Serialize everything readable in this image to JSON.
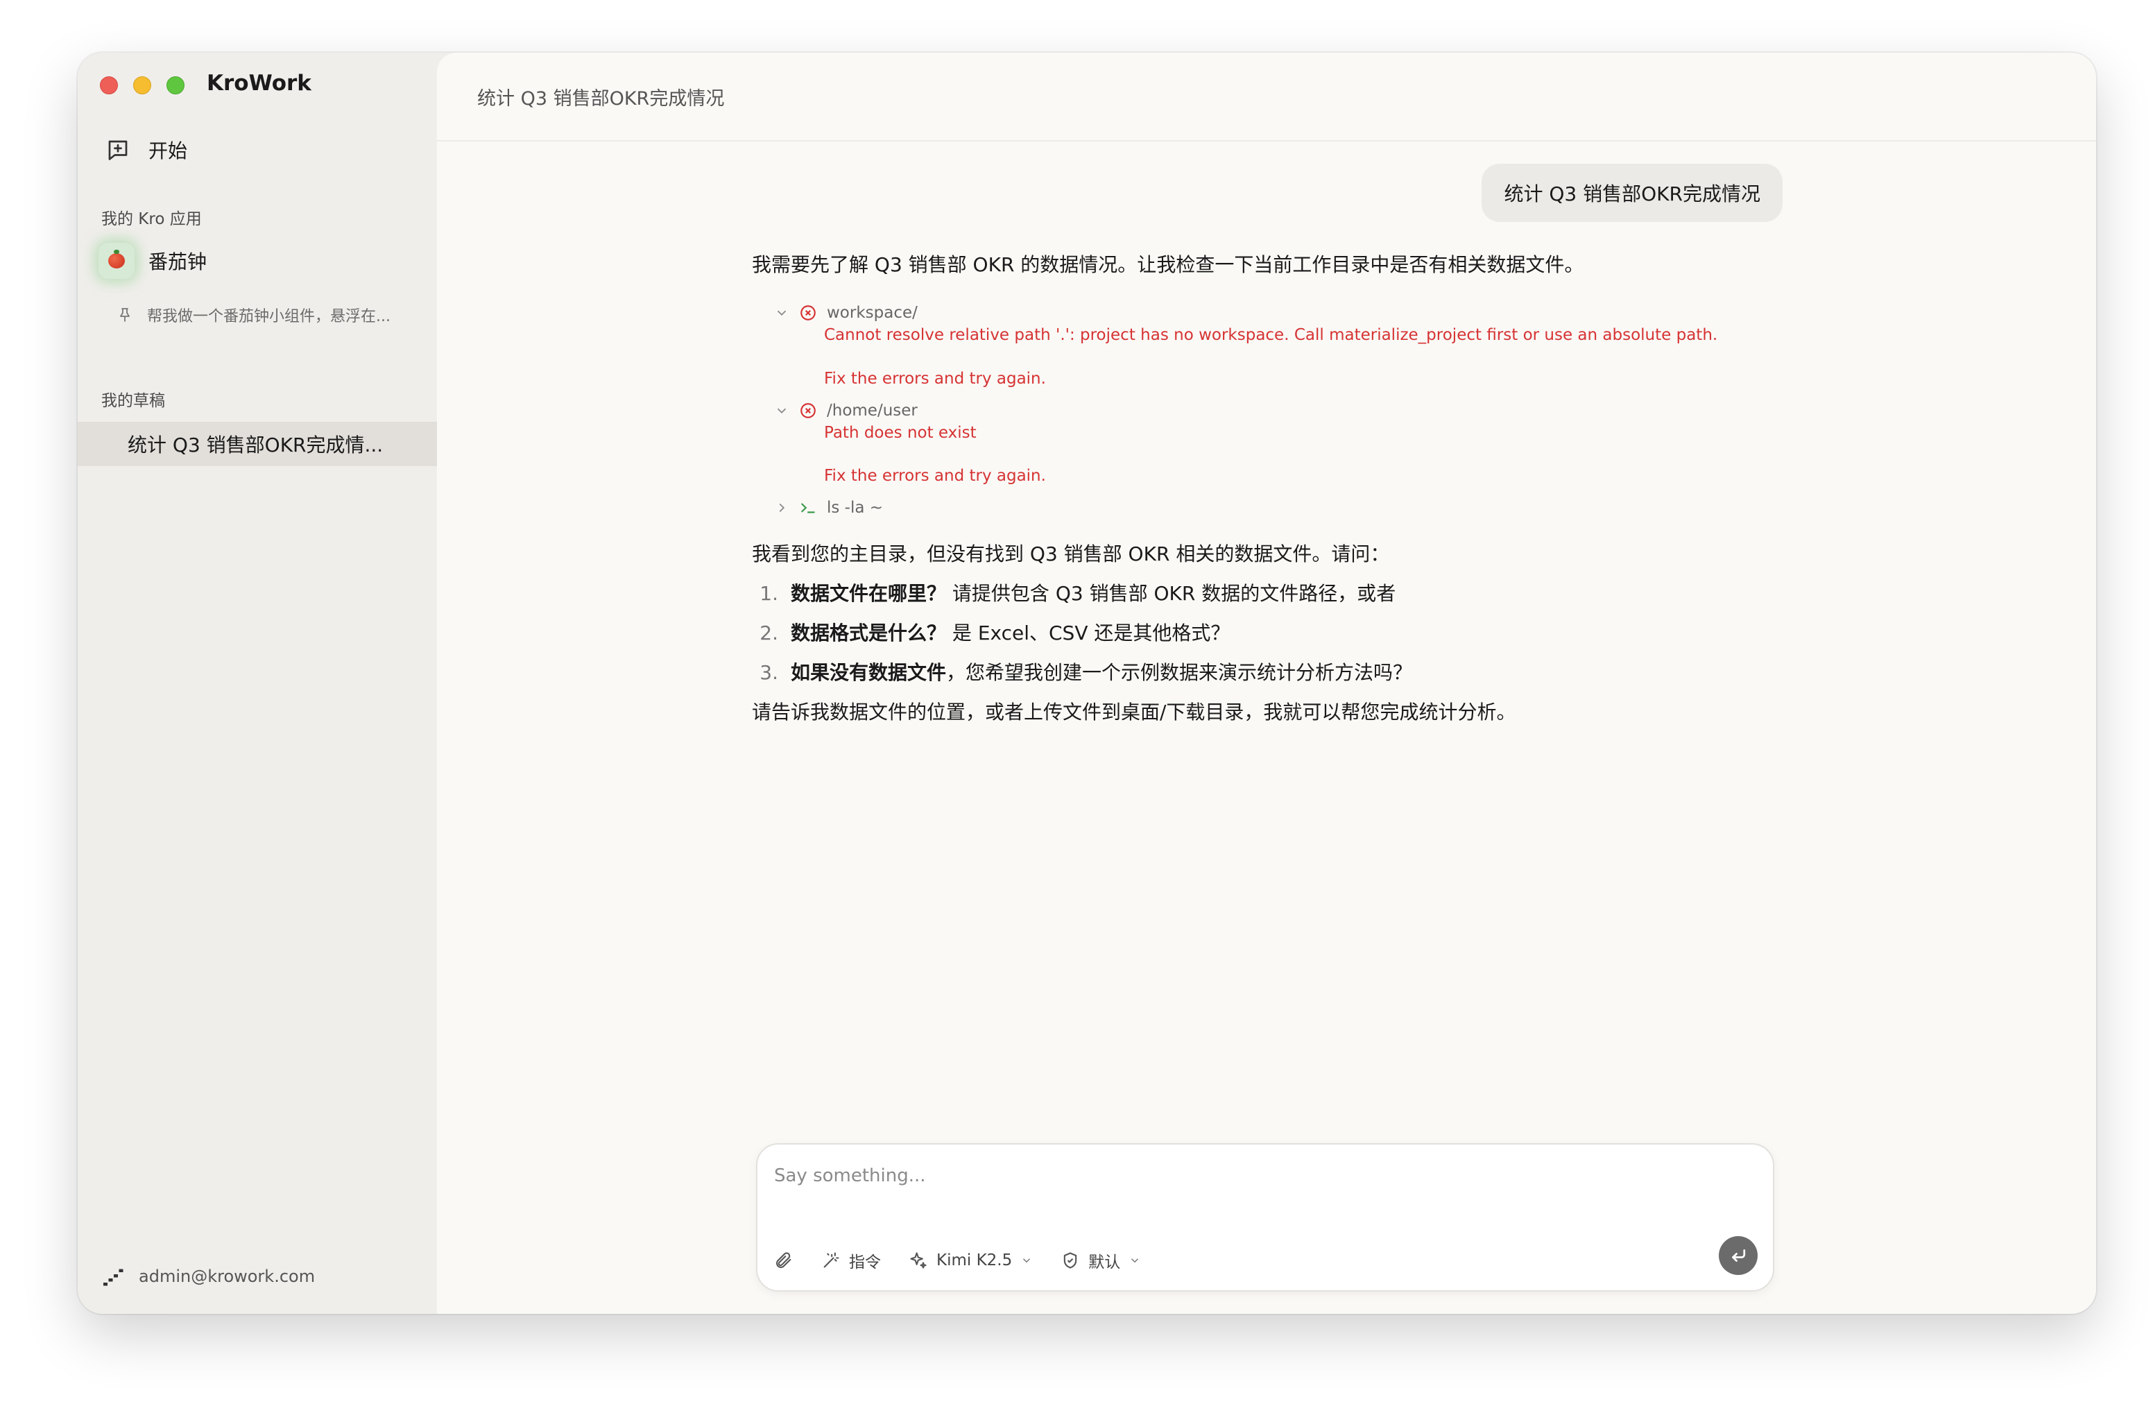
{
  "app": {
    "title": "KroWork"
  },
  "sidebar": {
    "start_label": "开始",
    "apps_section_label": "我的 Kro 应用",
    "app_item_label": "番茄钟",
    "pinned_text": "帮我做一个番茄钟小组件，悬浮在...",
    "drafts_section_label": "我的草稿",
    "draft_item_label": "统计 Q3 销售部OKR完成情...",
    "user_email": "admin@krowork.com"
  },
  "topbar": {
    "title": "统计 Q3 销售部OKR完成情况"
  },
  "conversation": {
    "user_message": "统计 Q3 销售部OKR完成情况",
    "intro": "我需要先了解 Q3 销售部 OKR 的数据情况。让我检查一下当前工作目录中是否有相关数据文件。",
    "tool_calls": [
      {
        "name": "workspace/",
        "error": "Cannot resolve relative path '.': project has no workspace. Call materialize_project first or use an absolute path.",
        "hint": "Fix the errors and try again."
      },
      {
        "name": "/home/user",
        "error": "Path does not exist",
        "hint": "Fix the errors and try again."
      },
      {
        "name": "ls -la ~"
      }
    ],
    "followup": "我看到您的主目录，但没有找到 Q3 销售部 OKR 相关的数据文件。请问：",
    "questions": [
      {
        "num": "1.",
        "bold": "数据文件在哪里？",
        "text": "请提供包含 Q3 销售部 OKR 数据的文件路径，或者"
      },
      {
        "num": "2.",
        "bold": "数据格式是什么？",
        "text": "是 Excel、CSV 还是其他格式？"
      },
      {
        "num": "3.",
        "bold": "如果没有数据文件",
        "text": "，您希望我创建一个示例数据来演示统计分析方法吗？"
      }
    ],
    "closing": "请告诉我数据文件的位置，或者上传文件到桌面/下载目录，我就可以帮您完成统计分析。"
  },
  "composer": {
    "placeholder": "Say something...",
    "command_label": "指令",
    "model_label": "Kimi K2.5",
    "permission_label": "默认"
  },
  "colors": {
    "error": "#d63333",
    "send_button": "#6b6b6b",
    "sidebar_bg": "#f0eeeb",
    "main_bg": "#faf9f6"
  }
}
